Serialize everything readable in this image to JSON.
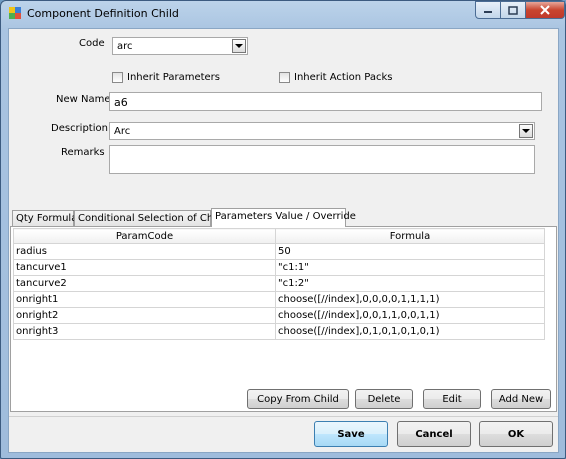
{
  "window": {
    "title": "Component Definition Child"
  },
  "form": {
    "code_label": "Code",
    "code_value": "arc",
    "inherit_parameters_label": "Inherit Parameters",
    "inherit_action_packs_label": "Inherit Action Packs",
    "new_name_label": "New Name",
    "new_name_value": "a6",
    "description_label": "Description",
    "description_value": "Arc",
    "remarks_label": "Remarks",
    "remarks_value": ""
  },
  "tabs": [
    {
      "label": "Qty Formula"
    },
    {
      "label": "Conditional Selection of Child"
    },
    {
      "label": "Parameters Value / Override"
    }
  ],
  "grid": {
    "columns": [
      "ParamCode",
      "Formula"
    ],
    "rows": [
      {
        "code": "radius",
        "formula": "50"
      },
      {
        "code": "tancurve1",
        "formula": "\"c1:1\""
      },
      {
        "code": "tancurve2",
        "formula": "\"c1:2\""
      },
      {
        "code": "onright1",
        "formula": "choose([//index],0,0,0,0,1,1,1,1)"
      },
      {
        "code": "onright2",
        "formula": "choose([//index],0,0,1,1,0,0,1,1)"
      },
      {
        "code": "onright3",
        "formula": "choose([//index],0,1,0,1,0,1,0,1)"
      }
    ]
  },
  "grid_buttons": {
    "copy_from_child": "Copy From Child",
    "delete": "Delete",
    "edit": "Edit",
    "add_new": "Add New"
  },
  "dialog_buttons": {
    "save": "Save",
    "cancel": "Cancel",
    "ok": "OK"
  },
  "colors": {
    "title_bar": "#bcd3ea",
    "client_bg": "#f0f0f0",
    "primary_button": "#bee6fd",
    "close_button": "#c9452f"
  }
}
